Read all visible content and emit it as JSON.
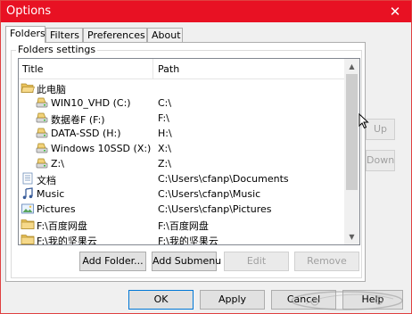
{
  "window": {
    "title": "Options",
    "close_symbol": "✕"
  },
  "tabs": [
    {
      "label": "Folders",
      "active": true
    },
    {
      "label": "Filters",
      "active": false
    },
    {
      "label": "Preferences",
      "active": false
    },
    {
      "label": "About",
      "active": false
    }
  ],
  "folders_settings": {
    "group_title": "Folders settings",
    "columns": {
      "title": "Title",
      "path": "Path"
    },
    "rows": [
      {
        "icon": "folder-open-icon",
        "title": "此电脑",
        "path": ""
      },
      {
        "icon": "drive-icon",
        "title": "WIN10_VHD (C:)",
        "path": "C:\\"
      },
      {
        "icon": "drive-icon",
        "title": "数据卷F (F:)",
        "path": "F:\\"
      },
      {
        "icon": "drive-icon",
        "title": "DATA-SSD (H:)",
        "path": "H:\\"
      },
      {
        "icon": "drive-icon",
        "title": "Windows 10SSD (X:)",
        "path": "X:\\"
      },
      {
        "icon": "drive-icon",
        "title": "Z:\\",
        "path": "Z:\\"
      },
      {
        "icon": "documents-icon",
        "title": "文档",
        "path": "C:\\Users\\cfanp\\Documents"
      },
      {
        "icon": "music-icon",
        "title": "Music",
        "path": "C:\\Users\\cfanp\\Music"
      },
      {
        "icon": "pictures-icon",
        "title": "Pictures",
        "path": "C:\\Users\\cfanp\\Pictures"
      },
      {
        "icon": "folder-icon",
        "title": "F:\\百度网盘",
        "path": "F:\\百度网盘"
      },
      {
        "icon": "folder-icon",
        "title": "F:\\我的坚果云",
        "path": "F:\\我的坚果云"
      }
    ]
  },
  "side_buttons": {
    "up": "Up",
    "down": "Down"
  },
  "panel_buttons": {
    "add_folder": "Add Folder...",
    "add_submenu": "Add Submenu",
    "edit": "Edit",
    "remove": "Remove"
  },
  "dialog_buttons": {
    "ok": "OK",
    "apply": "Apply",
    "cancel": "Cancel",
    "help": "Help"
  },
  "colors": {
    "titlebar": "#e81123",
    "focus_border": "#0078d7",
    "folder": "#e8c15a"
  }
}
